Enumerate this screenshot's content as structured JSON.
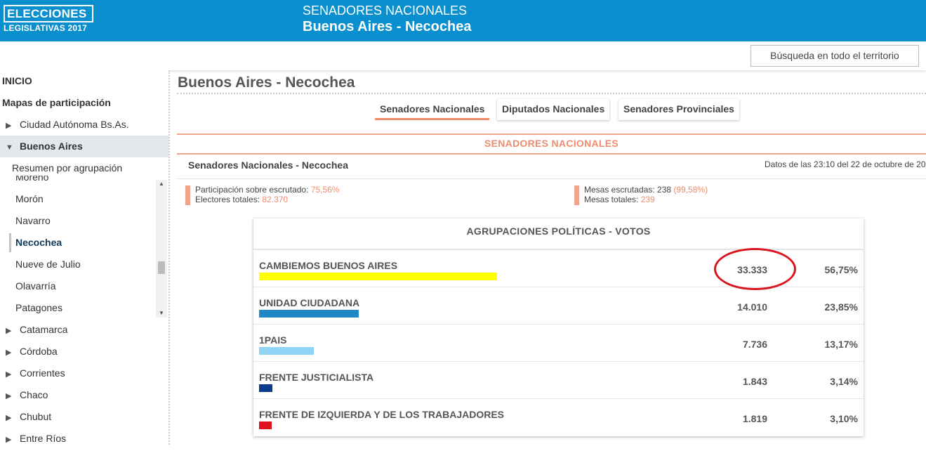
{
  "header": {
    "logo_line1": "ELECCIONES",
    "logo_line2": "LEGISLATIVAS 2017",
    "subtitle": "SENADORES NACIONALES",
    "title": "Buenos Aires - Necochea"
  },
  "search": {
    "label": "Búsqueda en todo el territorio"
  },
  "sidebar": {
    "inicio": "INICIO",
    "mapas": "Mapas de participación",
    "caba": "Ciudad Autónoma Bs.As.",
    "buenos_aires": "Buenos Aires",
    "resumen": "Resumen por agrupación",
    "partial": "Moreno",
    "municipios": [
      "Morón",
      "Navarro",
      "Necochea",
      "Nueve de Julio",
      "Olavarría",
      "Patagones"
    ],
    "provincias": [
      "Catamarca",
      "Córdoba",
      "Corrientes",
      "Chaco",
      "Chubut",
      "Entre Ríos"
    ]
  },
  "main": {
    "title": "Buenos Aires - Necochea",
    "tabs": [
      "Senadores Nacionales",
      "Diputados Nacionales",
      "Senadores Provinciales"
    ],
    "section_title": "SENADORES NACIONALES",
    "sub_head": "Senadores Nacionales - Necochea",
    "datos": "Datos de las 23:10 del 22 de octubre de 20",
    "stats": {
      "participacion_label": "Participación sobre escrutado: ",
      "participacion_value": "75,56%",
      "electores_label": "Electores totales: ",
      "electores_value": "82.370",
      "mesas_escrutadas_label": "Mesas escrutadas: 238 ",
      "mesas_escrutadas_value": "(99,58%)",
      "mesas_totales_label": "Mesas totales: ",
      "mesas_totales_value": "239"
    },
    "results_title": "AGRUPACIONES POLÍTICAS - VOTOS",
    "results": [
      {
        "name": "CAMBIEMOS BUENOS AIRES",
        "votes": "33.333",
        "pct": "56,75%",
        "color": "#ffff00",
        "bar_fraction": 1.0
      },
      {
        "name": "UNIDAD CIUDADANA",
        "votes": "14.010",
        "pct": "23,85%",
        "color": "#1e88c7",
        "bar_fraction": 0.42
      },
      {
        "name": "1PAIS",
        "votes": "7.736",
        "pct": "13,17%",
        "color": "#8fd3f5",
        "bar_fraction": 0.23
      },
      {
        "name": "FRENTE JUSTICIALISTA",
        "votes": "1.843",
        "pct": "3,14%",
        "color": "#0b3c8c",
        "bar_fraction": 0.055
      },
      {
        "name": "FRENTE DE IZQUIERDA Y DE LOS TRABAJADORES",
        "votes": "1.819",
        "pct": "3,10%",
        "color": "#e0101e",
        "bar_fraction": 0.054
      }
    ]
  }
}
